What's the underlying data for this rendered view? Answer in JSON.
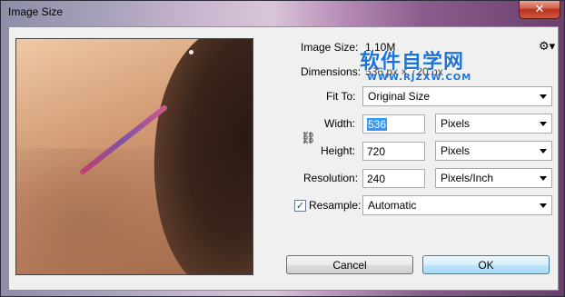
{
  "window": {
    "title": "Image Size",
    "close_label": "✕"
  },
  "info": {
    "image_size_label": "Image Size:",
    "image_size_value": "1.10M",
    "dimensions_label": "Dimensions:",
    "dimensions_value": "536 px × 720 px",
    "gear_icon": "⚙▾"
  },
  "form": {
    "fit_to_label": "Fit To:",
    "fit_to_value": "Original Size",
    "width_label": "Width:",
    "width_value": "536",
    "width_unit": "Pixels",
    "height_label": "Height:",
    "height_value": "720",
    "height_unit": "Pixels",
    "resolution_label": "Resolution:",
    "resolution_value": "240",
    "resolution_unit": "Pixels/Inch",
    "resample_label": "Resample:",
    "resample_checked": "✓",
    "resample_value": "Automatic",
    "link_icon": "⛓"
  },
  "buttons": {
    "cancel": "Cancel",
    "ok": "OK"
  },
  "watermark": {
    "text": "软件自学网",
    "url": "WWW.RJZXW.COM"
  }
}
